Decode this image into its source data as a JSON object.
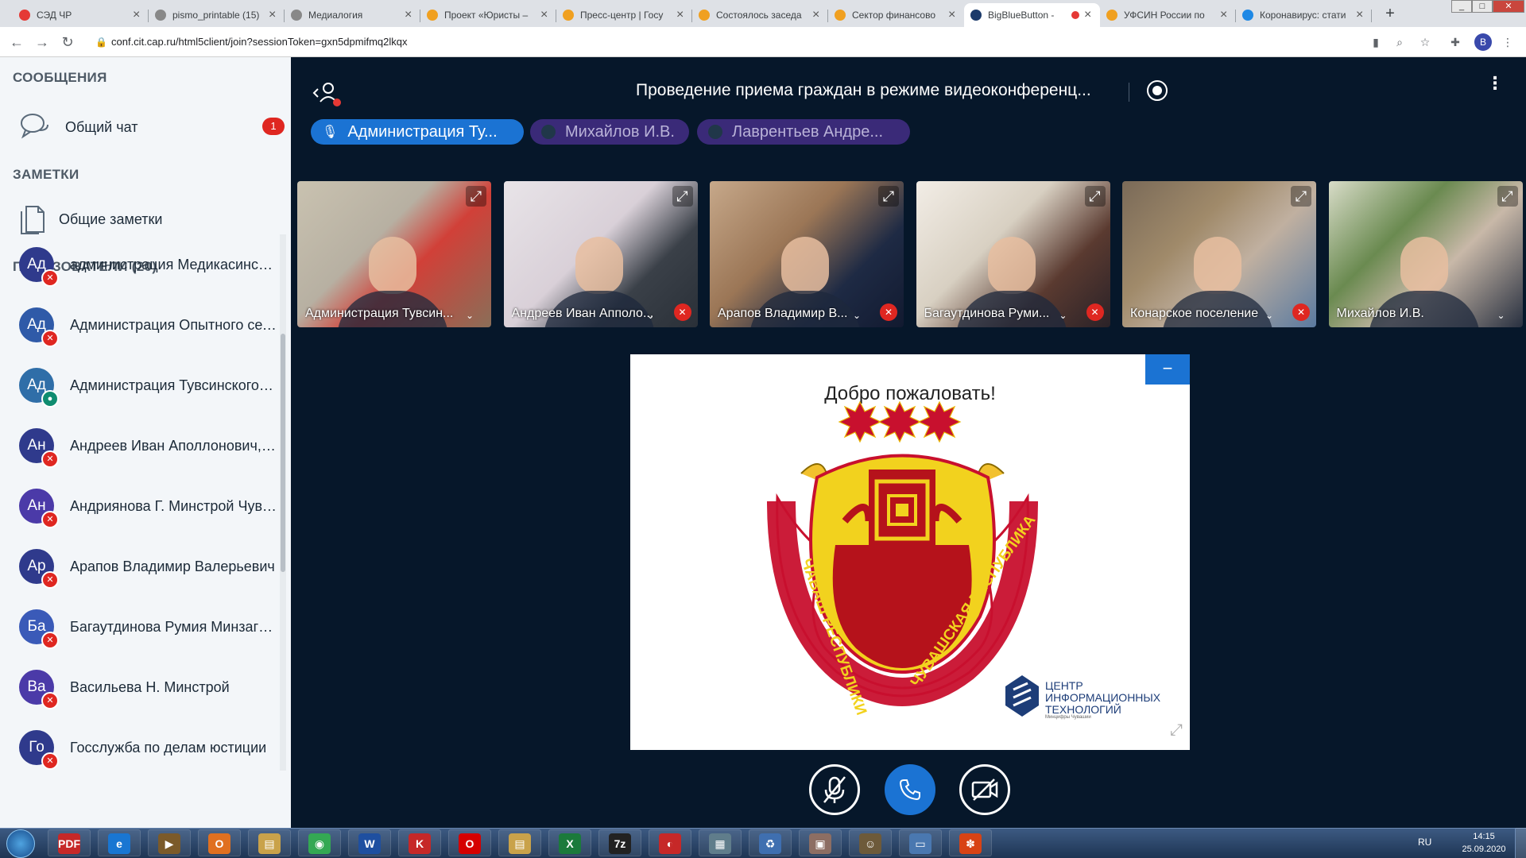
{
  "browser": {
    "tabs": [
      {
        "title": "СЭД ЧР",
        "fav": "#e53935"
      },
      {
        "title": "pismo_printable (15)",
        "fav": "#888"
      },
      {
        "title": "Медиалогия",
        "fav": "#888"
      },
      {
        "title": "Проект «Юристы –",
        "fav": "#f0a020"
      },
      {
        "title": "Пресс-центр | Госу",
        "fav": "#f0a020"
      },
      {
        "title": "Состоялось заседа",
        "fav": "#f0a020"
      },
      {
        "title": "Сектор финансово",
        "fav": "#f0a020"
      },
      {
        "title": "BigBlueButton -",
        "fav": "#1b3a6a"
      },
      {
        "title": "УФСИН России по",
        "fav": "#f0a020"
      },
      {
        "title": "Коронавирус: стати",
        "fav": "#1e88e5"
      }
    ],
    "url": "conf.cit.cap.ru/html5client/join?sessionToken=gxn5dpmifmq2lkqx",
    "profile_initial": "B",
    "new_tab": "+",
    "recording_dot_color": "#e53935"
  },
  "sidebar": {
    "messages_header": "СООБЩЕНИЯ",
    "public_chat": "Общий чат",
    "chat_badge": "1",
    "notes_header": "ЗАМЕТКИ",
    "shared_notes": "Общие заметки",
    "users_header": "ПОЛЬЗОВАТЕЛИ (20)",
    "users": [
      {
        "initials": "Ад",
        "name": "администрация Медикасинского с...",
        "color": "#2f3a8c",
        "mic": "muted"
      },
      {
        "initials": "Ад",
        "name": "Администрация Опытного сельско...",
        "color": "#2f5aa8",
        "mic": "muted"
      },
      {
        "initials": "Ад",
        "name": "Администрация Тувсинского сельс...",
        "color": "#2f6ea8",
        "mic": "talking"
      },
      {
        "initials": "Ан",
        "name": "Андреев Иван Аполлонович, Пре...",
        "color": "#2f3a8c",
        "mic": "muted"
      },
      {
        "initials": "Ан",
        "name": "Андриянова Г. Минстрой Чувашии",
        "color": "#4b3aa8",
        "mic": "muted"
      },
      {
        "initials": "Ар",
        "name": "Арапов Владимир Валерьевич",
        "color": "#2f3a8c",
        "mic": "muted"
      },
      {
        "initials": "Ба",
        "name": "Багаутдинова Румия Минзагитов...",
        "color": "#3a5ab8",
        "mic": "muted"
      },
      {
        "initials": "Ва",
        "name": "Васильева Н. Минстрой",
        "color": "#4b3aa8",
        "mic": "muted"
      },
      {
        "initials": "Го",
        "name": "Госслужба по делам юстиции",
        "color": "#2f3a8c",
        "mic": "muted"
      }
    ]
  },
  "main": {
    "meeting_title": "Проведение приема граждан в режиме видеоконференц...",
    "more": "⋮",
    "talkers": [
      {
        "name": "Администрация Ту...",
        "active": true
      },
      {
        "name": "Михайлов И.В.",
        "active": false
      },
      {
        "name": "Лаврентьев Андре...",
        "active": false
      }
    ],
    "videos": [
      {
        "name": "Администрация Тувсин...",
        "muted": false
      },
      {
        "name": "Андреев Иван Апполо...",
        "muted": true
      },
      {
        "name": "Арапов Владимир В...",
        "muted": true
      },
      {
        "name": "Багаутдинова Руми...",
        "muted": true
      },
      {
        "name": "Конарское поселение",
        "muted": true
      },
      {
        "name": "Михайлов И.В.",
        "muted": false
      }
    ],
    "presentation": {
      "title": "Добро пожаловать!",
      "emblem_left": "ЧĂВАШ РЕСПУБЛИКИ",
      "emblem_right": "ЧУВАШСКАЯ РЕСПУБЛИКА",
      "cit_text": "ЦЕНТР ИНФОРМАЦИОННЫХ ТЕХНОЛОГИЙ",
      "cit_sub": "Минцифры Чувашии",
      "minimize": "−",
      "fullscreen": "⤢"
    }
  },
  "taskbar": {
    "lang": "RU",
    "time": "14:15",
    "date": "25.09.2020",
    "apps": [
      {
        "label": "PDF",
        "color": "#c62828"
      },
      {
        "label": "e",
        "color": "#1976d2"
      },
      {
        "label": "▶",
        "color": "#7b5a2a"
      },
      {
        "label": "O",
        "color": "#e07020"
      },
      {
        "label": "▤",
        "color": "#c9a24a"
      },
      {
        "label": "◉",
        "color": "#34a853"
      },
      {
        "label": "W",
        "color": "#1e4fa0"
      },
      {
        "label": "K",
        "color": "#c62828"
      },
      {
        "label": "O",
        "color": "#d50000"
      },
      {
        "label": "▤",
        "color": "#c9a24a"
      },
      {
        "label": "X",
        "color": "#1b7a3b"
      },
      {
        "label": "7z",
        "color": "#222"
      },
      {
        "label": "◐",
        "color": "#c62828"
      },
      {
        "label": "▦",
        "color": "#607d8b"
      },
      {
        "label": "♻",
        "color": "#3f6fb0"
      },
      {
        "label": "▣",
        "color": "#8d6e63"
      },
      {
        "label": "☺",
        "color": "#6d5a3a"
      },
      {
        "label": "▭",
        "color": "#4a78b0"
      },
      {
        "label": "✽",
        "color": "#d84315"
      }
    ]
  }
}
